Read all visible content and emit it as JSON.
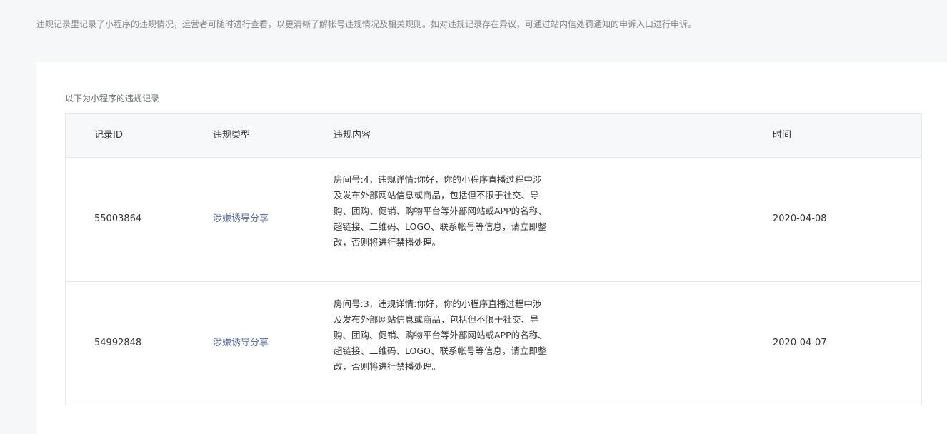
{
  "intro_text": "违规记录里记录了小程序的违规情况，运营者可随时进行查看，以更清晰了解帐号违规情况及相关规则。如对违规记录存在异议，可通过站内信处罚通知的申诉入口进行申诉。",
  "section_title": "以下为小程序的违规记录",
  "table": {
    "headers": [
      "记录ID",
      "违规类型",
      "违规内容",
      "时间"
    ],
    "rows": [
      {
        "id": "55003864",
        "type": "涉嫌诱导分享",
        "content": "房间号:4，违规详情:你好，你的小程序直播过程中涉及发布外部网站信息或商品，包括但不限于社交、导购、团购、促销、购物平台等外部网站或APP的名称、超链接、二维码、LOGO、联系帐号等信息，请立即整改，否则将进行禁播处理。",
        "time": "2020-04-08"
      },
      {
        "id": "54992848",
        "type": "涉嫌诱导分享",
        "content": "房间号:3，违规详情:你好，你的小程序直播过程中涉及发布外部网站信息或商品，包括但不限于社交、导购、团购、促销、购物平台等外部网站或APP的名称、超链接、二维码、LOGO、联系帐号等信息，请立即整改，否则将进行禁播处理。",
        "time": "2020-04-07"
      }
    ]
  },
  "colors": {
    "page_bg": "#f6f7f9",
    "card_bg": "#ffffff",
    "header_bg": "#f6f8f9",
    "border": "#e7e7eb",
    "link": "#576b95",
    "muted_text": "#7f8389"
  }
}
